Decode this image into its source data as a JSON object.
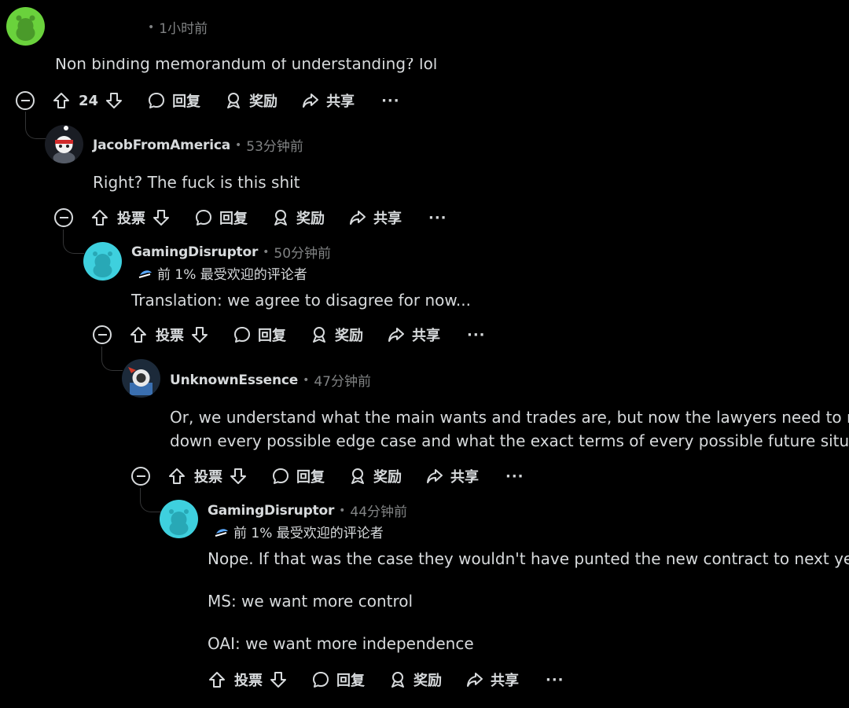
{
  "colors": {
    "background": "#000000",
    "text": "#d7dadc",
    "muted": "#818384",
    "line": "#343536"
  },
  "comments": [
    {
      "username": "",
      "time": "1小时前",
      "body": [
        "Non binding memorandum of understanding? lol"
      ],
      "actions": {
        "vote": "24",
        "reply": "回复",
        "award": "奖励",
        "share": "共享",
        "more": "···"
      }
    },
    {
      "username": "JacobFromAmerica",
      "time": "53分钟前",
      "body": [
        "Right? The fuck is this shit"
      ],
      "actions": {
        "vote": "投票",
        "reply": "回复",
        "award": "奖励",
        "share": "共享",
        "more": "···"
      }
    },
    {
      "username": "GamingDisruptor",
      "time": "50分钟前",
      "flair": "前 1% 最受欢迎的评论者",
      "body": [
        "Translation: we agree to disagree for now..."
      ],
      "actions": {
        "vote": "投票",
        "reply": "回复",
        "award": "奖励",
        "share": "共享",
        "more": "···"
      }
    },
    {
      "username": "UnknownEssence",
      "time": "47分钟前",
      "body": [
        "Or, we understand what the main wants and trades are, but now the lawyers need to nail",
        "down every possible edge case and what the exact terms of every possible future situation"
      ],
      "actions": {
        "vote": "投票",
        "reply": "回复",
        "award": "奖励",
        "share": "共享",
        "more": "···"
      }
    },
    {
      "username": "GamingDisruptor",
      "time": "44分钟前",
      "flair": "前 1% 最受欢迎的评论者",
      "body": [
        "Nope. If that was the case they wouldn't have punted the new contract to next year",
        "MS: we want more control",
        "OAI: we want more independence"
      ],
      "actions": {
        "vote": "投票",
        "reply": "回复",
        "award": "奖励",
        "share": "共享",
        "more": "···"
      }
    }
  ],
  "icons": [
    "collapse-icon",
    "upvote-icon",
    "downvote-icon",
    "reply-icon",
    "award-icon",
    "share-icon",
    "more-icon",
    "flair-icon",
    "avatar-snoo-icon"
  ]
}
